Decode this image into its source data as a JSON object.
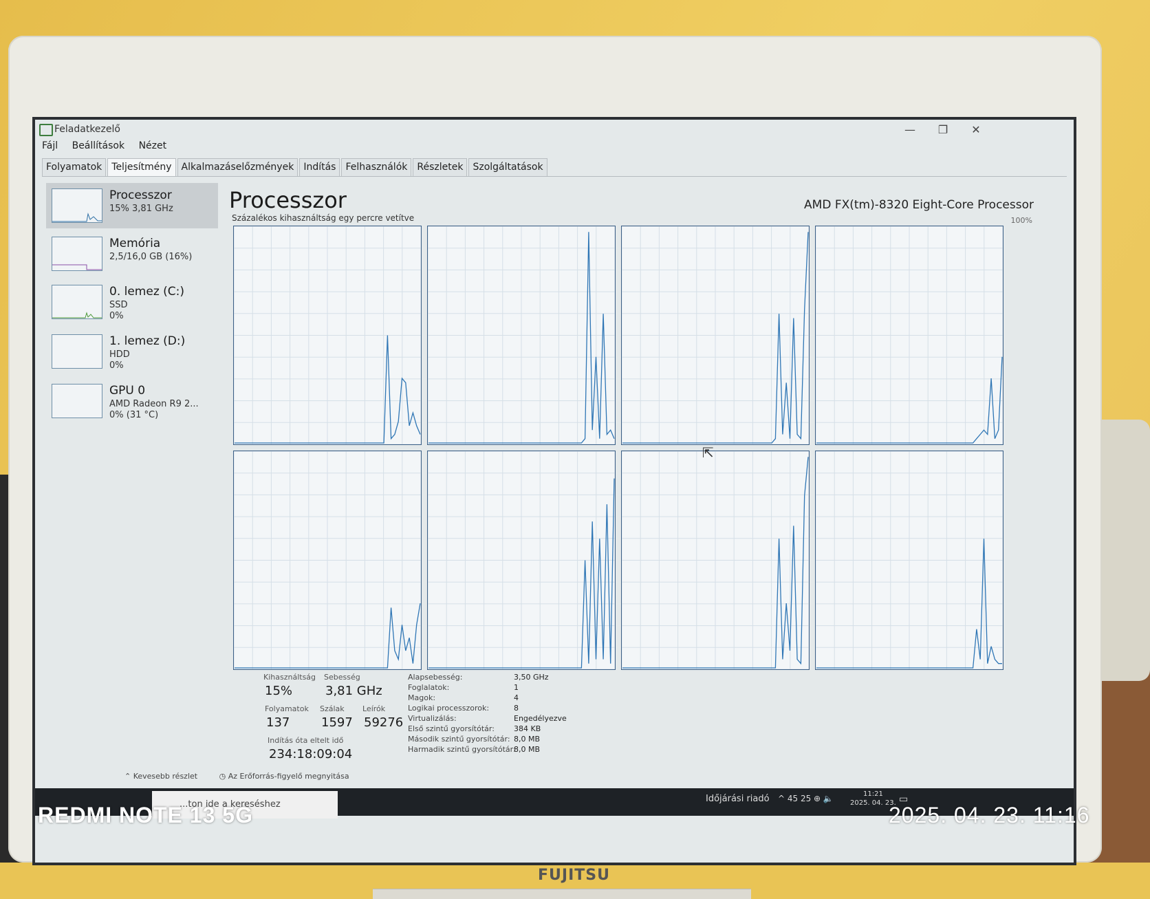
{
  "window": {
    "title": "Feladatkezelő",
    "menu": [
      "Fájl",
      "Beállítások",
      "Nézet"
    ],
    "controls": {
      "minimize": "—",
      "restore": "❐",
      "close": "✕"
    }
  },
  "tabs": [
    "Folyamatok",
    "Teljesítmény",
    "Alkalmazáselőzmények",
    "Indítás",
    "Felhasználók",
    "Részletek",
    "Szolgáltatások"
  ],
  "sidebar": {
    "items": [
      {
        "title": "Processzor",
        "sub1": "15% 3,81 GHz",
        "sub2": "",
        "sub3": ""
      },
      {
        "title": "Memória",
        "sub1": "2,5/16,0 GB (16%)",
        "sub2": "",
        "sub3": ""
      },
      {
        "title": "0. lemez (C:)",
        "sub1": "SSD",
        "sub2": "0%",
        "sub3": ""
      },
      {
        "title": "1. lemez (D:)",
        "sub1": "HDD",
        "sub2": "0%",
        "sub3": ""
      },
      {
        "title": "GPU 0",
        "sub1": "AMD Radeon R9 2...",
        "sub2": "0% (31 °C)",
        "sub3": ""
      }
    ]
  },
  "main": {
    "title": "Processzor",
    "cpu_name": "AMD FX(tm)-8320 Eight-Core Processor",
    "chart_caption": "Százalékos kihasználtság egy percre vetítve",
    "max_label": "100%"
  },
  "chart_data": {
    "type": "line",
    "title": "",
    "ylim": [
      0,
      100
    ],
    "grid": true,
    "series": [
      {
        "values": [
          0,
          0,
          0,
          0,
          0,
          0,
          0,
          0,
          0,
          0,
          0,
          0,
          0,
          0,
          0,
          0,
          0,
          0,
          0,
          0,
          0,
          0,
          0,
          0,
          0,
          0,
          0,
          0,
          0,
          0,
          0,
          0,
          0,
          0,
          0,
          0,
          0,
          0,
          0,
          0,
          0,
          0,
          50,
          2,
          4,
          10,
          30,
          28,
          8,
          14,
          8,
          4
        ]
      },
      {
        "values": [
          0,
          0,
          0,
          0,
          0,
          0,
          0,
          0,
          0,
          0,
          0,
          0,
          0,
          0,
          0,
          0,
          0,
          0,
          0,
          0,
          0,
          0,
          0,
          0,
          0,
          0,
          0,
          0,
          0,
          0,
          0,
          0,
          0,
          0,
          0,
          0,
          0,
          0,
          0,
          0,
          0,
          0,
          0,
          2,
          98,
          6,
          40,
          2,
          60,
          4,
          6,
          2
        ]
      },
      {
        "values": [
          0,
          0,
          0,
          0,
          0,
          0,
          0,
          0,
          0,
          0,
          0,
          0,
          0,
          0,
          0,
          0,
          0,
          0,
          0,
          0,
          0,
          0,
          0,
          0,
          0,
          0,
          0,
          0,
          0,
          0,
          0,
          0,
          0,
          0,
          0,
          0,
          0,
          0,
          0,
          0,
          0,
          0,
          2,
          60,
          4,
          28,
          2,
          58,
          4,
          2,
          62,
          98
        ]
      },
      {
        "values": [
          0,
          0,
          0,
          0,
          0,
          0,
          0,
          0,
          0,
          0,
          0,
          0,
          0,
          0,
          0,
          0,
          0,
          0,
          0,
          0,
          0,
          0,
          0,
          0,
          0,
          0,
          0,
          0,
          0,
          0,
          0,
          0,
          0,
          0,
          0,
          0,
          0,
          0,
          0,
          0,
          0,
          0,
          0,
          0,
          2,
          4,
          6,
          4,
          30,
          2,
          6,
          40
        ]
      },
      {
        "values": [
          0,
          0,
          0,
          0,
          0,
          0,
          0,
          0,
          0,
          0,
          0,
          0,
          0,
          0,
          0,
          0,
          0,
          0,
          0,
          0,
          0,
          0,
          0,
          0,
          0,
          0,
          0,
          0,
          0,
          0,
          0,
          0,
          0,
          0,
          0,
          0,
          0,
          0,
          0,
          0,
          0,
          0,
          0,
          28,
          8,
          4,
          20,
          8,
          14,
          2,
          20,
          30
        ]
      },
      {
        "values": [
          0,
          0,
          0,
          0,
          0,
          0,
          0,
          0,
          0,
          0,
          0,
          0,
          0,
          0,
          0,
          0,
          0,
          0,
          0,
          0,
          0,
          0,
          0,
          0,
          0,
          0,
          0,
          0,
          0,
          0,
          0,
          0,
          0,
          0,
          0,
          0,
          0,
          0,
          0,
          0,
          0,
          0,
          0,
          50,
          2,
          68,
          4,
          60,
          4,
          76,
          2,
          88
        ]
      },
      {
        "values": [
          0,
          0,
          0,
          0,
          0,
          0,
          0,
          0,
          0,
          0,
          0,
          0,
          0,
          0,
          0,
          0,
          0,
          0,
          0,
          0,
          0,
          0,
          0,
          0,
          0,
          0,
          0,
          0,
          0,
          0,
          0,
          0,
          0,
          0,
          0,
          0,
          0,
          0,
          0,
          0,
          0,
          0,
          0,
          60,
          4,
          30,
          8,
          66,
          4,
          2,
          80,
          98
        ]
      },
      {
        "values": [
          0,
          0,
          0,
          0,
          0,
          0,
          0,
          0,
          0,
          0,
          0,
          0,
          0,
          0,
          0,
          0,
          0,
          0,
          0,
          0,
          0,
          0,
          0,
          0,
          0,
          0,
          0,
          0,
          0,
          0,
          0,
          0,
          0,
          0,
          0,
          0,
          0,
          0,
          0,
          0,
          0,
          0,
          0,
          0,
          18,
          4,
          60,
          2,
          10,
          4,
          2,
          2
        ]
      }
    ]
  },
  "stats": {
    "util_label": "Kihasználtság",
    "util_value": "15%",
    "speed_label": "Sebesség",
    "speed_value": "3,81 GHz",
    "proc_label": "Folyamatok",
    "proc_value": "137",
    "threads_label": "Szálak",
    "threads_value": "1597",
    "handles_label": "Leírók",
    "handles_value": "59276",
    "uptime_label": "Indítás óta eltelt idő",
    "uptime_value": "234:18:09:04"
  },
  "specs": [
    {
      "label": "Alapsebesség:",
      "value": "3,50 GHz"
    },
    {
      "label": "Foglalatok:",
      "value": "1"
    },
    {
      "label": "Magok:",
      "value": "4"
    },
    {
      "label": "Logikai processzorok:",
      "value": "8"
    },
    {
      "label": "Virtualizálás:",
      "value": "Engedélyezve"
    },
    {
      "label": "Első szintű gyorsítótár:",
      "value": "384 KB"
    },
    {
      "label": "Második szintű gyorsítótár:",
      "value": "8,0 MB"
    },
    {
      "label": "Harmadik szintű gyorsítótár:",
      "value": "8,0 MB"
    }
  ],
  "footer": {
    "fewer_details": "Kevesebb részlet",
    "resource_monitor": "Az Erőforrás-figyelő megnyitása"
  },
  "taskbar": {
    "search_text": "...ton ide a kereséshez",
    "weather": "Időjárási riadó",
    "tray": "^  45  25  ⊕  🔈",
    "time": "11:21",
    "date": "2025. 04. 23."
  },
  "device": {
    "brand": "FUJITSU",
    "photo_model": "REDMI NOTE 13 5G",
    "photo_timestamp": "2025. 04. 23. 11:16"
  }
}
